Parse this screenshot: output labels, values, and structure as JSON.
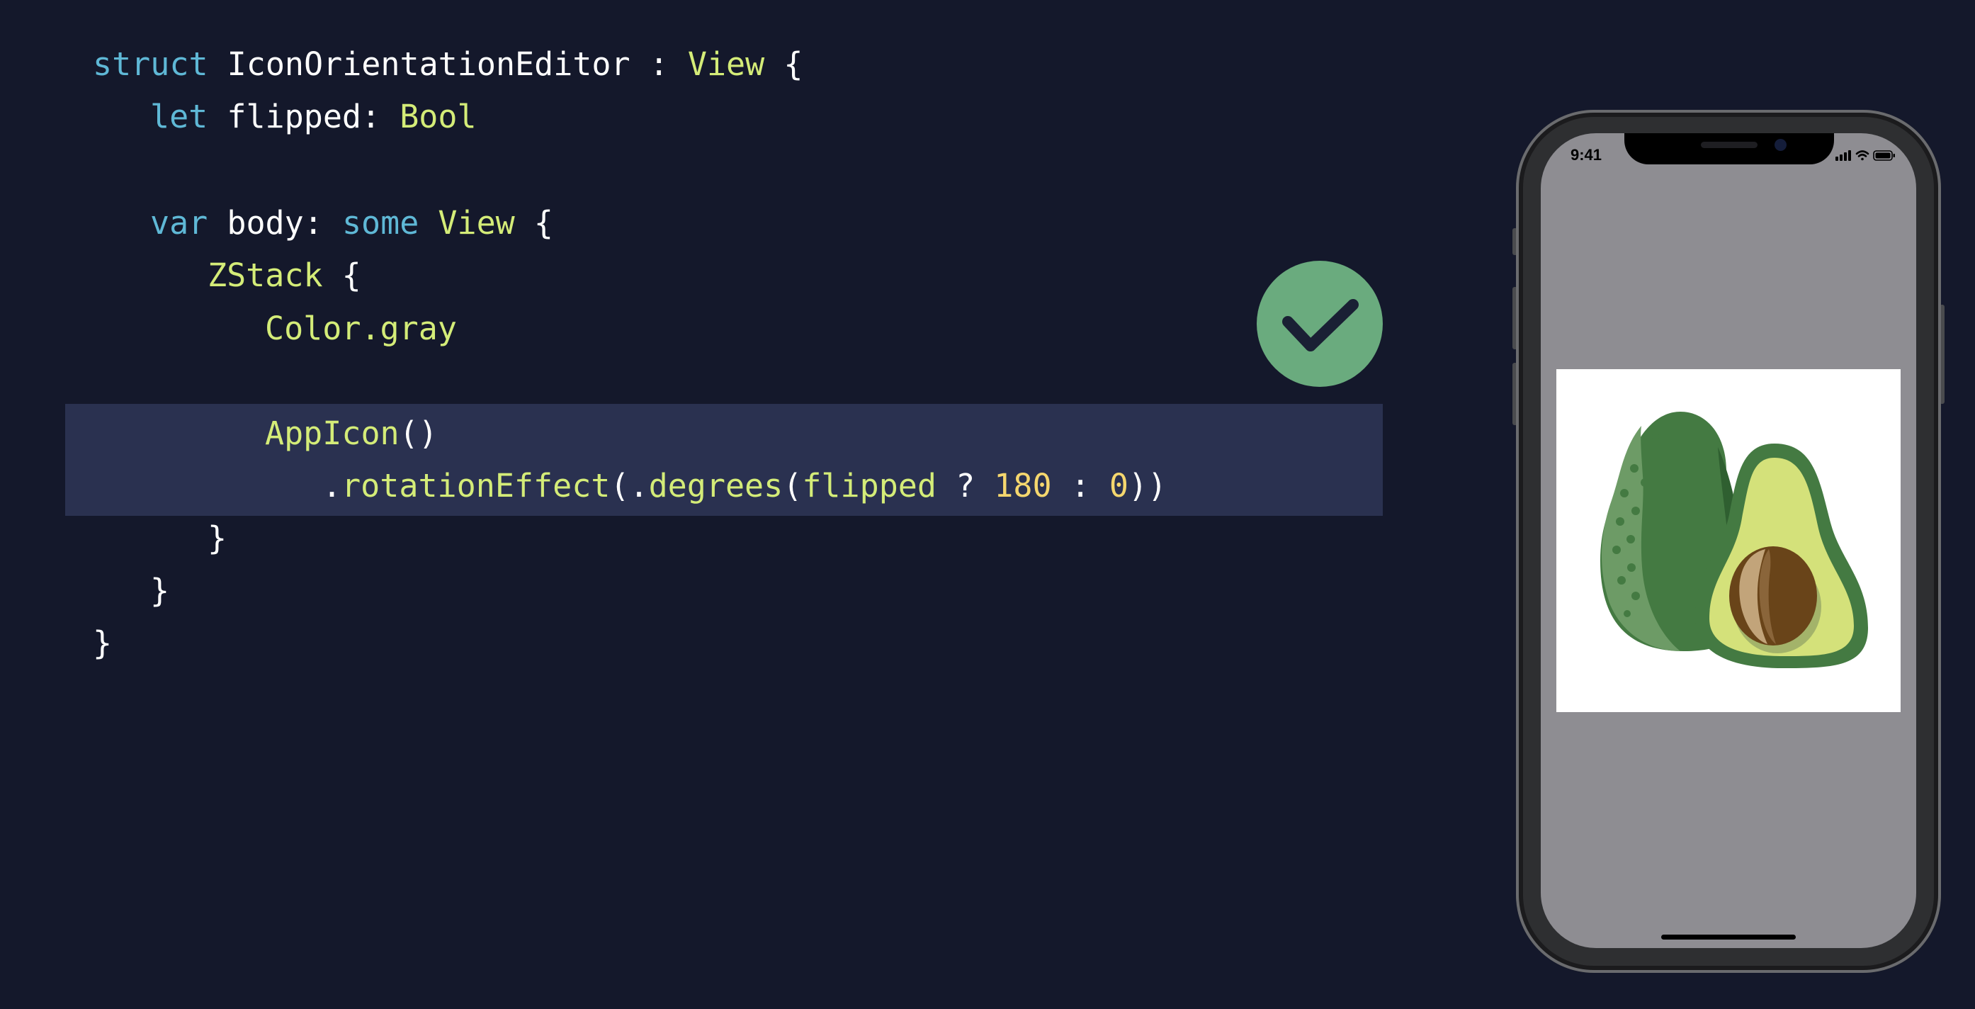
{
  "code": {
    "lines": [
      [
        {
          "t": "struct",
          "c": "kw"
        },
        {
          "t": " IconOrientationEditor : ",
          "c": "pl"
        },
        {
          "t": "View",
          "c": "ty"
        },
        {
          "t": " {",
          "c": "pl"
        }
      ],
      [
        {
          "t": "let",
          "c": "kw"
        },
        {
          "t": " flipped: ",
          "c": "pl"
        },
        {
          "t": "Bool",
          "c": "ty"
        }
      ],
      [],
      [
        {
          "t": "var",
          "c": "kw"
        },
        {
          "t": " body: ",
          "c": "pl"
        },
        {
          "t": "some",
          "c": "kw"
        },
        {
          "t": " ",
          "c": "pl"
        },
        {
          "t": "View",
          "c": "ty"
        },
        {
          "t": " {",
          "c": "pl"
        }
      ],
      [
        {
          "t": "ZStack",
          "c": "ty"
        },
        {
          "t": " {",
          "c": "pl"
        }
      ],
      [
        {
          "t": "Color.gray",
          "c": "ty"
        }
      ],
      [],
      [
        {
          "t": "AppIcon",
          "c": "ty"
        },
        {
          "t": "()",
          "c": "pl"
        }
      ],
      [
        {
          "t": ".",
          "c": "pl"
        },
        {
          "t": "rotationEffect",
          "c": "ty"
        },
        {
          "t": "(.",
          "c": "pl"
        },
        {
          "t": "degrees",
          "c": "ty"
        },
        {
          "t": "(",
          "c": "pl"
        },
        {
          "t": "flipped",
          "c": "ty"
        },
        {
          "t": " ? ",
          "c": "pl"
        },
        {
          "t": "180",
          "c": "num"
        },
        {
          "t": " : ",
          "c": "pl"
        },
        {
          "t": "0",
          "c": "num"
        },
        {
          "t": "))",
          "c": "pl"
        }
      ],
      [
        {
          "t": "}",
          "c": "pl"
        }
      ],
      [
        {
          "t": "}",
          "c": "pl"
        }
      ],
      [
        {
          "t": "}",
          "c": "pl"
        }
      ]
    ]
  },
  "colors": {
    "background": "#14182b",
    "highlight": "#2a3150",
    "keyword": "#5fb8d6",
    "type": "#d4ec78",
    "plain": "#ffffff",
    "number": "#f5d76e",
    "check_badge": "#6aab7e",
    "screen": "#8e8d92"
  },
  "phone": {
    "status_time": "9:41",
    "icons": [
      "signal-icon",
      "wifi-icon",
      "battery-icon"
    ]
  },
  "badge": {
    "icon": "checkmark-icon"
  },
  "app_icon": {
    "icon": "avocado-icon"
  }
}
